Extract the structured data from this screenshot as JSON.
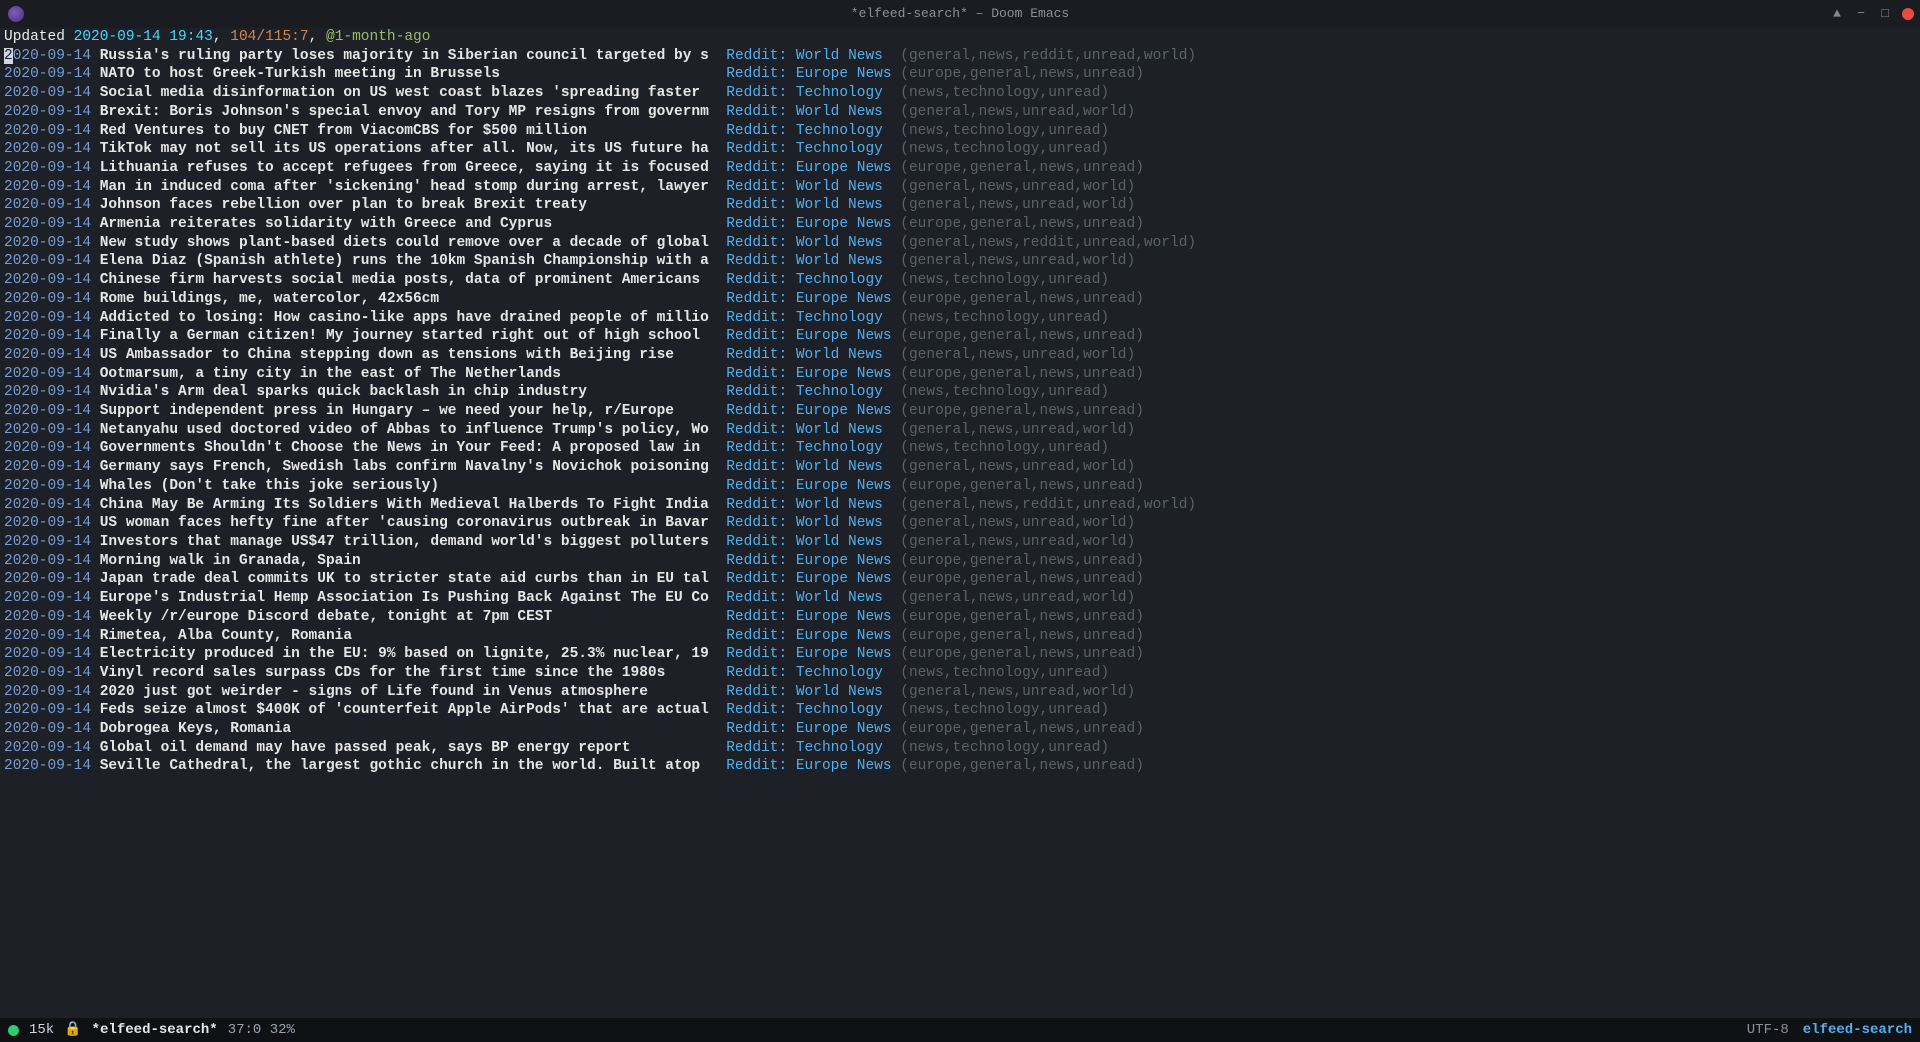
{
  "titlebar": {
    "text": "*elfeed-search* – Doom Emacs",
    "min_icon": "−",
    "max_icon": "□"
  },
  "header": {
    "updated_label": "Updated ",
    "timestamp": "2020-09-14 19:43",
    "sep": ", ",
    "count": "104/115:7",
    "sep2": ", ",
    "filter": "@1-month-ago"
  },
  "entries": [
    {
      "date": "2020-09-14",
      "title": "Russia's ruling party loses majority in Siberian council targeted by s",
      "feed": "Reddit: World News",
      "tags": "(general,news,reddit,unread,world)"
    },
    {
      "date": "2020-09-14",
      "title": "NATO to host Greek-Turkish meeting in Brussels",
      "feed": "Reddit: Europe News",
      "tags": "(europe,general,news,unread)"
    },
    {
      "date": "2020-09-14",
      "title": "Social media disinformation on US west coast blazes 'spreading faster",
      "feed": "Reddit: Technology",
      "tags": "(news,technology,unread)"
    },
    {
      "date": "2020-09-14",
      "title": "Brexit: Boris Johnson's special envoy and Tory MP resigns from governm",
      "feed": "Reddit: World News",
      "tags": "(general,news,unread,world)"
    },
    {
      "date": "2020-09-14",
      "title": "Red Ventures to buy CNET from ViacomCBS for $500 million",
      "feed": "Reddit: Technology",
      "tags": "(news,technology,unread)"
    },
    {
      "date": "2020-09-14",
      "title": "TikTok may not sell its US operations after all. Now, its US future ha",
      "feed": "Reddit: Technology",
      "tags": "(news,technology,unread)"
    },
    {
      "date": "2020-09-14",
      "title": "Lithuania refuses to accept refugees from Greece, saying it is focused",
      "feed": "Reddit: Europe News",
      "tags": "(europe,general,news,unread)"
    },
    {
      "date": "2020-09-14",
      "title": "Man in induced coma after 'sickening' head stomp during arrest, lawyer",
      "feed": "Reddit: World News",
      "tags": "(general,news,unread,world)"
    },
    {
      "date": "2020-09-14",
      "title": "Johnson faces rebellion over plan to break Brexit treaty",
      "feed": "Reddit: World News",
      "tags": "(general,news,unread,world)"
    },
    {
      "date": "2020-09-14",
      "title": "Armenia reiterates solidarity with Greece and Cyprus",
      "feed": "Reddit: Europe News",
      "tags": "(europe,general,news,unread)"
    },
    {
      "date": "2020-09-14",
      "title": "New study shows plant-based diets could remove over a decade of global",
      "feed": "Reddit: World News",
      "tags": "(general,news,reddit,unread,world)"
    },
    {
      "date": "2020-09-14",
      "title": "Elena Diaz (Spanish athlete) runs the 10km Spanish Championship with a",
      "feed": "Reddit: World News",
      "tags": "(general,news,unread,world)"
    },
    {
      "date": "2020-09-14",
      "title": "Chinese firm harvests social media posts, data of prominent Americans",
      "feed": "Reddit: Technology",
      "tags": "(news,technology,unread)"
    },
    {
      "date": "2020-09-14",
      "title": "Rome buildings, me, watercolor, 42x56cm",
      "feed": "Reddit: Europe News",
      "tags": "(europe,general,news,unread)"
    },
    {
      "date": "2020-09-14",
      "title": "Addicted to losing: How casino-like apps have drained people of millio",
      "feed": "Reddit: Technology",
      "tags": "(news,technology,unread)"
    },
    {
      "date": "2020-09-14",
      "title": "Finally a German citizen! My journey started right out of high school",
      "feed": "Reddit: Europe News",
      "tags": "(europe,general,news,unread)"
    },
    {
      "date": "2020-09-14",
      "title": "US Ambassador to China stepping down as tensions with Beijing rise",
      "feed": "Reddit: World News",
      "tags": "(general,news,unread,world)"
    },
    {
      "date": "2020-09-14",
      "title": "Ootmarsum, a tiny city in the east of The Netherlands",
      "feed": "Reddit: Europe News",
      "tags": "(europe,general,news,unread)"
    },
    {
      "date": "2020-09-14",
      "title": "Nvidia's Arm deal sparks quick backlash in chip industry",
      "feed": "Reddit: Technology",
      "tags": "(news,technology,unread)"
    },
    {
      "date": "2020-09-14",
      "title": "Support independent press in Hungary – we need your help, r/Europe",
      "feed": "Reddit: Europe News",
      "tags": "(europe,general,news,unread)"
    },
    {
      "date": "2020-09-14",
      "title": "Netanyahu used doctored video of Abbas to influence Trump's policy, Wo",
      "feed": "Reddit: World News",
      "tags": "(general,news,unread,world)"
    },
    {
      "date": "2020-09-14",
      "title": "Governments Shouldn't Choose the News in Your Feed: A proposed law in",
      "feed": "Reddit: Technology",
      "tags": "(news,technology,unread)"
    },
    {
      "date": "2020-09-14",
      "title": "Germany says French, Swedish labs confirm Navalny's Novichok poisoning",
      "feed": "Reddit: World News",
      "tags": "(general,news,unread,world)"
    },
    {
      "date": "2020-09-14",
      "title": "Whales (Don't take this joke seriously)",
      "feed": "Reddit: Europe News",
      "tags": "(europe,general,news,unread)"
    },
    {
      "date": "2020-09-14",
      "title": "China May Be Arming Its Soldiers With Medieval Halberds To Fight India",
      "feed": "Reddit: World News",
      "tags": "(general,news,reddit,unread,world)"
    },
    {
      "date": "2020-09-14",
      "title": "US woman faces hefty fine after 'causing coronavirus outbreak in Bavar",
      "feed": "Reddit: World News",
      "tags": "(general,news,unread,world)"
    },
    {
      "date": "2020-09-14",
      "title": "Investors that manage US$47 trillion, demand world's biggest polluters",
      "feed": "Reddit: World News",
      "tags": "(general,news,unread,world)"
    },
    {
      "date": "2020-09-14",
      "title": "Morning walk in Granada, Spain",
      "feed": "Reddit: Europe News",
      "tags": "(europe,general,news,unread)"
    },
    {
      "date": "2020-09-14",
      "title": "Japan trade deal commits UK to stricter state aid curbs than in EU tal",
      "feed": "Reddit: Europe News",
      "tags": "(europe,general,news,unread)"
    },
    {
      "date": "2020-09-14",
      "title": "Europe's Industrial Hemp Association Is Pushing Back Against The EU Co",
      "feed": "Reddit: World News",
      "tags": "(general,news,unread,world)"
    },
    {
      "date": "2020-09-14",
      "title": "Weekly /r/europe Discord debate, tonight at 7pm CEST",
      "feed": "Reddit: Europe News",
      "tags": "(europe,general,news,unread)"
    },
    {
      "date": "2020-09-14",
      "title": "Rimetea, Alba County, Romania",
      "feed": "Reddit: Europe News",
      "tags": "(europe,general,news,unread)"
    },
    {
      "date": "2020-09-14",
      "title": "Electricity produced in the EU: 9% based on lignite, 25.3% nuclear, 19",
      "feed": "Reddit: Europe News",
      "tags": "(europe,general,news,unread)"
    },
    {
      "date": "2020-09-14",
      "title": "Vinyl record sales surpass CDs for the first time since the 1980s",
      "feed": "Reddit: Technology",
      "tags": "(news,technology,unread)"
    },
    {
      "date": "2020-09-14",
      "title": "2020 just got weirder - signs of Life found in Venus atmosphere",
      "feed": "Reddit: World News",
      "tags": "(general,news,unread,world)"
    },
    {
      "date": "2020-09-14",
      "title": "Feds seize almost $400K of 'counterfeit Apple AirPods' that are actual",
      "feed": "Reddit: Technology",
      "tags": "(news,technology,unread)"
    },
    {
      "date": "2020-09-14",
      "title": "Dobrogea Keys, Romania",
      "feed": "Reddit: Europe News",
      "tags": "(europe,general,news,unread)"
    },
    {
      "date": "2020-09-14",
      "title": "Global oil demand may have passed peak, says BP energy report",
      "feed": "Reddit: Technology",
      "tags": "(news,technology,unread)"
    },
    {
      "date": "2020-09-14",
      "title": "Seville Cathedral, the largest gothic church in the world. Built atop",
      "feed": "Reddit: Europe News",
      "tags": "(europe,general,news,unread)"
    }
  ],
  "title_col_width": 71,
  "feed_col_width": 19,
  "modeline": {
    "size": "15k",
    "lock": "🔒",
    "buffer": "*elfeed-search*",
    "pos": "37:0 32%",
    "encoding": "UTF-8",
    "mode": "elfeed-search"
  }
}
